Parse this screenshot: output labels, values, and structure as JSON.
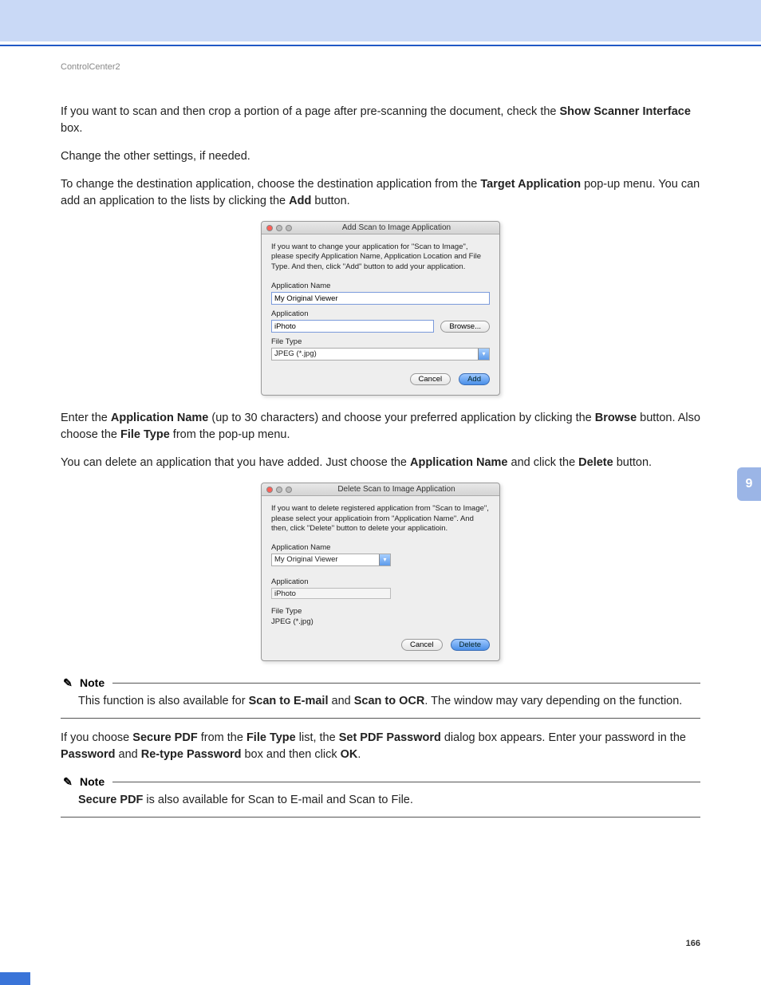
{
  "page": {
    "breadcrumb": "ControlCenter2",
    "chapter_tab": "9",
    "page_number": "166"
  },
  "paragraphs": {
    "p1a": "If you want to scan and then crop a portion of a page after pre-scanning the document, check the ",
    "p1b_bold": "Show Scanner Interface",
    "p1c": " box.",
    "p2": "Change the other settings, if needed.",
    "p3a": "To change the destination application, choose the destination application from the ",
    "p3b_bold": "Target Application",
    "p3c": " pop-up menu. You can add an application to the lists by clicking the ",
    "p3d_bold": "Add",
    "p3e": " button.",
    "p4a": "Enter the ",
    "p4b_bold": "Application Name",
    "p4c": " (up to 30 characters) and choose your preferred application by clicking the ",
    "p4d_bold": "Browse",
    "p4e": " button. Also choose the ",
    "p4f_bold": "File Type",
    "p4g": " from the pop-up menu.",
    "p5a": "You can delete an application that you have added. Just choose the ",
    "p5b_bold": "Application Name",
    "p5c": " and click the ",
    "p5d_bold": "Delete",
    "p5e": " button.",
    "p6a": "If you choose ",
    "p6b_bold": "Secure PDF",
    "p6c": " from the ",
    "p6d_bold": "File Type",
    "p6e": " list, the ",
    "p6f_bold": "Set PDF Password",
    "p6g": " dialog box appears. Enter your password in the ",
    "p6h_bold": "Password",
    "p6i": " and ",
    "p6j_bold": "Re-type Password",
    "p6k": " box and then click ",
    "p6l_bold": "OK",
    "p6m": "."
  },
  "dialog_add": {
    "title": "Add Scan to Image Application",
    "intro": "If you want to change your application for \"Scan to Image\", please specify Application Name, Application Location and File Type.\nAnd then, click \"Add\" button to add your application.",
    "lbl_appname": "Application Name",
    "val_appname": "My Original Viewer",
    "lbl_app": "Application",
    "val_app": "iPhoto",
    "btn_browse": "Browse...",
    "lbl_filetype": "File Type",
    "val_filetype": "JPEG (*.jpg)",
    "btn_cancel": "Cancel",
    "btn_add": "Add"
  },
  "dialog_del": {
    "title": "Delete Scan to Image Application",
    "intro": "If you want to delete registered application from \"Scan to Image\", please select your applicatioin from \"Application Name\".\nAnd then, click \"Delete\" button to delete your applicatioin.",
    "lbl_appname": "Application Name",
    "val_appname": "My Original Viewer",
    "lbl_app": "Application",
    "val_app": "iPhoto",
    "lbl_filetype": "File Type",
    "val_filetype": "JPEG (*.jpg)",
    "btn_cancel": "Cancel",
    "btn_delete": "Delete"
  },
  "notes": {
    "label": "Note",
    "n1a": "This function is also available for ",
    "n1b_bold": "Scan to E-mail",
    "n1c": " and ",
    "n1d_bold": "Scan to OCR",
    "n1e": ". The window may vary depending on the function.",
    "n2a_bold": "Secure PDF",
    "n2b": " is also available for Scan to E-mail and Scan to File."
  }
}
